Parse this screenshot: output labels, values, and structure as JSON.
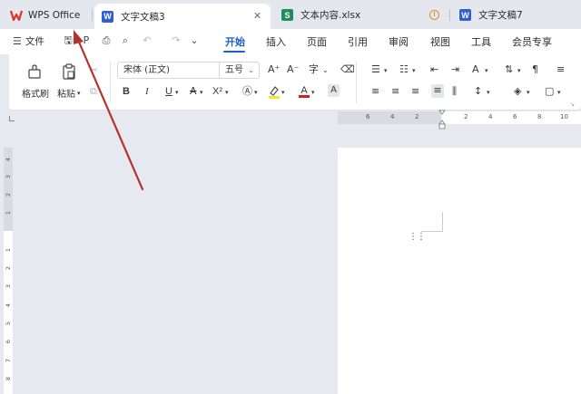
{
  "tabs": [
    {
      "label": "WPS Office"
    },
    {
      "label": "文字文稿3",
      "icon_letter": "W",
      "active": true
    },
    {
      "label": "文本内容.xlsx",
      "icon_letter": "S"
    },
    {
      "label": "文字文稿7",
      "icon_letter": "W"
    }
  ],
  "menu": {
    "file_label": "文件",
    "tabs": [
      "开始",
      "插入",
      "页面",
      "引用",
      "审阅",
      "视图",
      "工具",
      "会员专享"
    ],
    "active_tab": "开始"
  },
  "ribbon": {
    "format_painter_label": "格式刷",
    "paste_label": "粘贴",
    "font_name": "宋体 (正文)",
    "font_size": "五号",
    "bold": "B",
    "italic": "I",
    "underline": "U",
    "superscript": "X²",
    "grow_font": "A⁺",
    "shrink_font": "A⁻",
    "char_border": "A"
  },
  "ruler": {
    "h_ticks": [
      "6",
      "4",
      "2",
      "2",
      "4",
      "6",
      "8",
      "10"
    ],
    "v_ticks": [
      "4",
      "3",
      "2",
      "1",
      "1",
      "2",
      "3",
      "4",
      "5",
      "6",
      "7",
      "8"
    ]
  },
  "colors": {
    "accent": "#1a5fd0",
    "wps_red": "#e0312b",
    "word_blue": "#2f5fd0",
    "excel_green": "#1e8f5a",
    "annotation_arrow": "#b5322c"
  }
}
